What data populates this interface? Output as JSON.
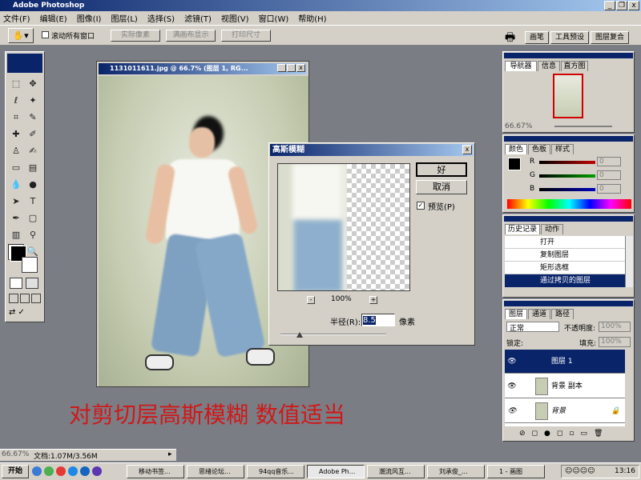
{
  "app": {
    "title": "Adobe Photoshop",
    "window_buttons": [
      "_",
      "❐",
      "x"
    ]
  },
  "menu": [
    "文件(F)",
    "编辑(E)",
    "图像(I)",
    "图层(L)",
    "选择(S)",
    "滤镜(T)",
    "视图(V)",
    "窗口(W)",
    "帮助(H)"
  ],
  "options": {
    "scroll_all": "滚动所有窗口",
    "btn_actual": "实际像素",
    "btn_fit": "满画布显示",
    "btn_print": "打印尺寸",
    "tabs": [
      "画笔",
      "工具预设",
      "图层复合"
    ]
  },
  "document": {
    "title": "1131011611.jpg @ 66.7% (图层 1, RG..."
  },
  "dialog": {
    "title": "高斯模糊",
    "ok": "好",
    "cancel": "取消",
    "preview": "预览(P)",
    "zoom": "100%",
    "zoom_out": "-",
    "zoom_in": "+",
    "radius_label": "半径(R):",
    "radius_value": "8.5",
    "unit": "像素"
  },
  "navigator": {
    "tabs": [
      "导航器",
      "信息",
      "直方图"
    ],
    "zoom": "66.67%"
  },
  "color": {
    "tabs": [
      "颜色",
      "色板",
      "样式"
    ],
    "channels": [
      {
        "label": "R",
        "value": "0",
        "color": "#c00000"
      },
      {
        "label": "G",
        "value": "0",
        "color": "#00a000"
      },
      {
        "label": "B",
        "value": "0",
        "color": "#0000c0"
      }
    ]
  },
  "history": {
    "tabs": [
      "历史记录",
      "动作"
    ],
    "items": [
      "打开",
      "复制图层",
      "矩形选框",
      "通过拷贝的图层"
    ]
  },
  "layers": {
    "tabs": [
      "图层",
      "通道",
      "路径"
    ],
    "blend": "正常",
    "opacity_label": "不透明度:",
    "opacity": "100%",
    "lock_label": "锁定:",
    "fill_label": "填充:",
    "fill": "100%",
    "items": [
      "图层 1",
      "背景 副本",
      "背景"
    ]
  },
  "status": {
    "zoom": "66.67%",
    "doc": "文档:1.07M/3.56M"
  },
  "caption": "对剪切层高斯模糊 数值适当",
  "taskbar": {
    "start": "开始",
    "items": [
      "移动书签...",
      "思绪论坛...",
      "94qq音乐...",
      "Adobe Ph...",
      "潮流风互...",
      "刘承俊_...",
      "1 - 画图"
    ],
    "time": "13:16"
  }
}
